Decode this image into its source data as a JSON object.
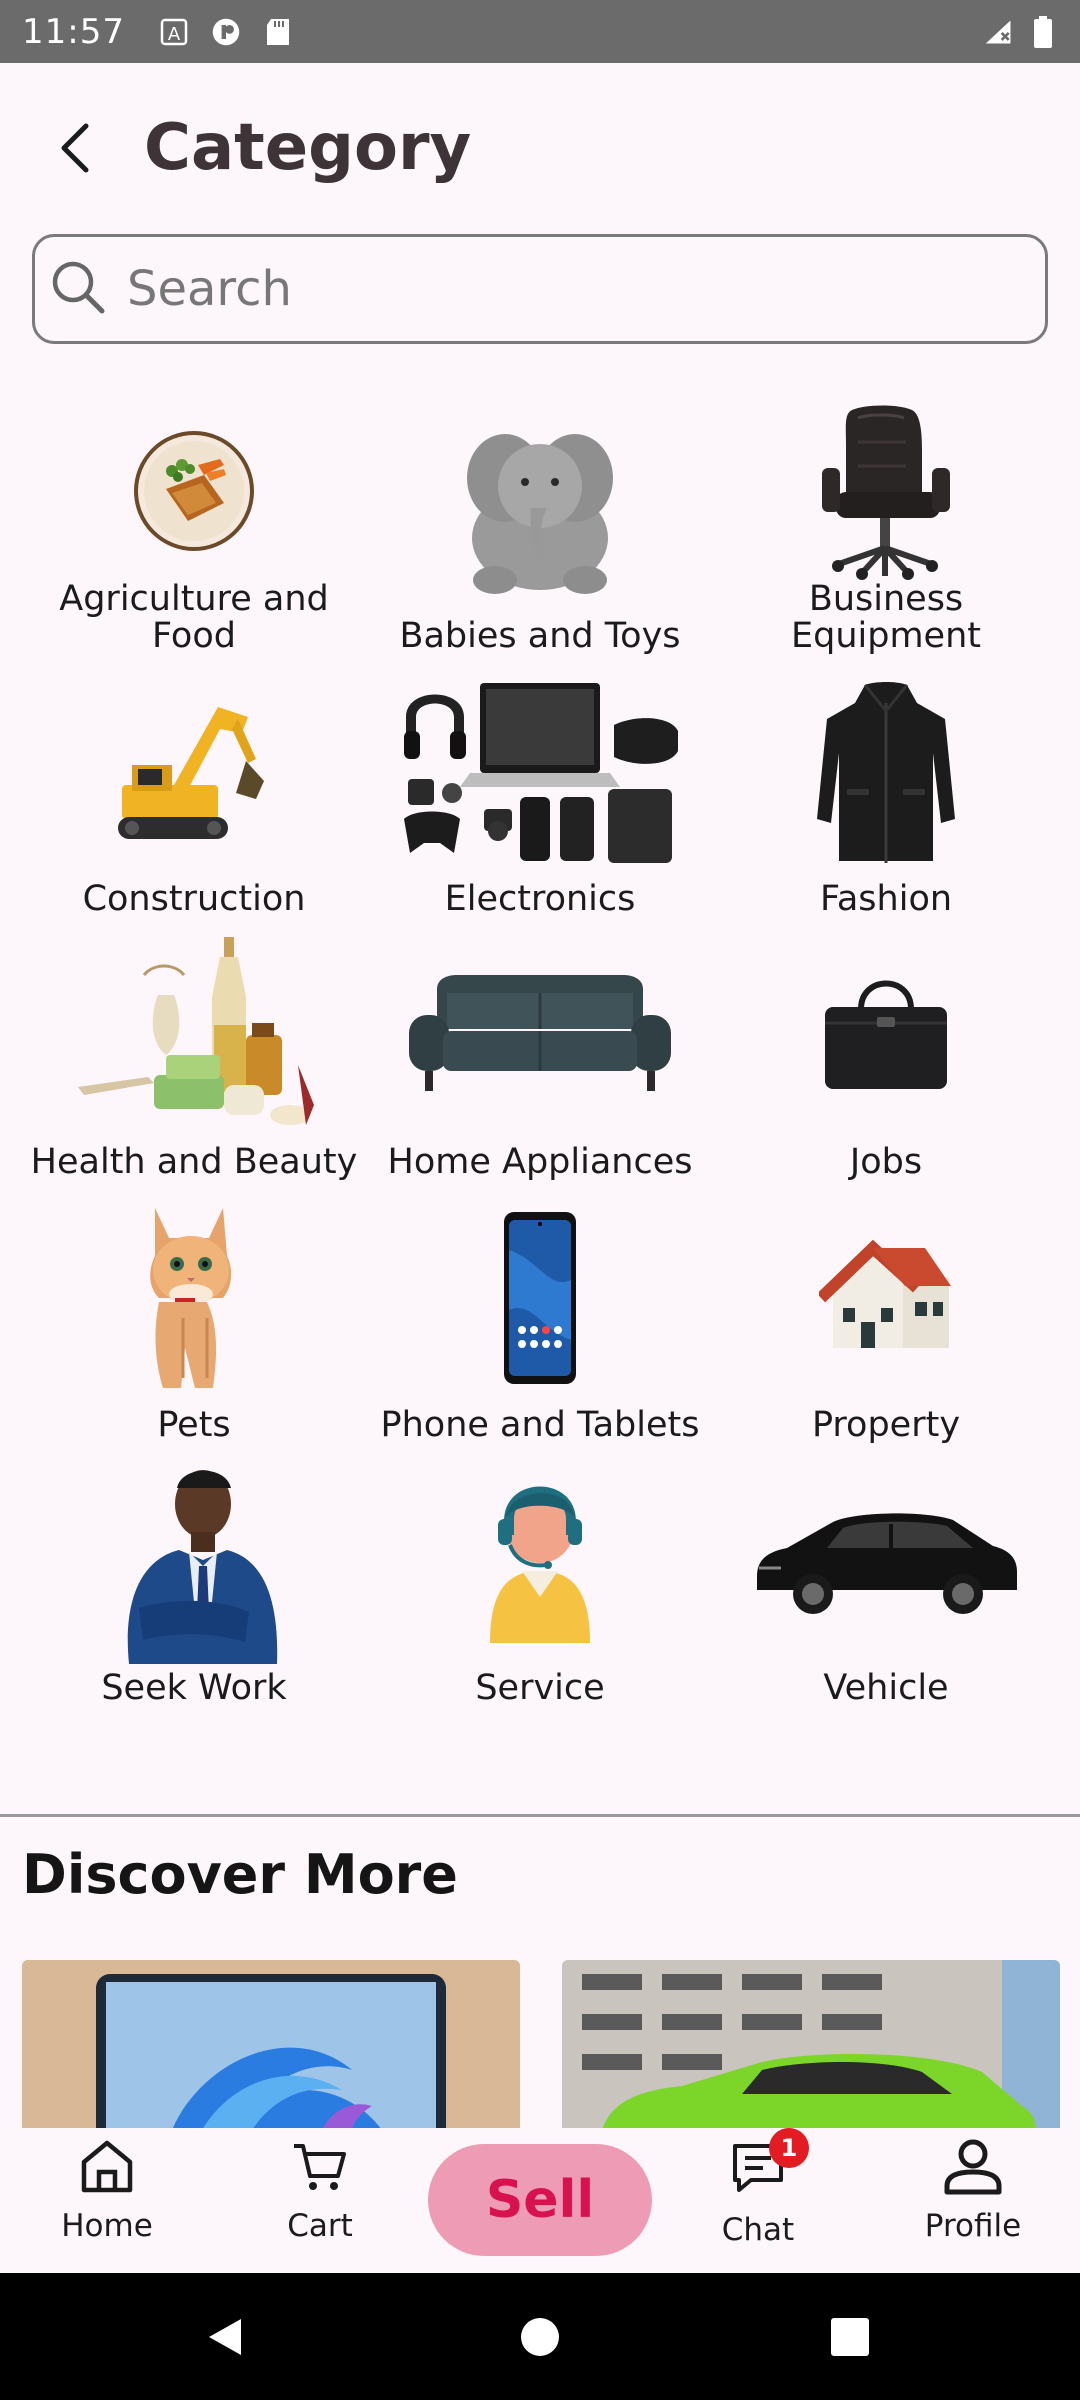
{
  "status_bar": {
    "time": "11:57"
  },
  "header": {
    "title": "Category"
  },
  "search": {
    "placeholder": "Search"
  },
  "categories": [
    {
      "label": "Agriculture and Food",
      "icon": "agriculture-food-icon"
    },
    {
      "label": "Babies and Toys",
      "icon": "toy-elephant-icon"
    },
    {
      "label": "Business Equipment",
      "icon": "office-chair-icon"
    },
    {
      "label": "Construction",
      "icon": "excavator-icon"
    },
    {
      "label": "Electronics",
      "icon": "electronics-icon"
    },
    {
      "label": "Fashion",
      "icon": "jacket-icon"
    },
    {
      "label": "Health and Beauty",
      "icon": "beauty-products-icon"
    },
    {
      "label": "Home Appliances",
      "icon": "sofa-icon"
    },
    {
      "label": "Jobs",
      "icon": "briefcase-icon"
    },
    {
      "label": "Pets",
      "icon": "cat-icon"
    },
    {
      "label": "Phone and Tablets",
      "icon": "smartphone-icon"
    },
    {
      "label": "Property",
      "icon": "house-icon"
    },
    {
      "label": "Seek Work",
      "icon": "businessman-icon"
    },
    {
      "label": "Service",
      "icon": "support-agent-icon"
    },
    {
      "label": "Vehicle",
      "icon": "car-icon"
    }
  ],
  "discover": {
    "title": "Discover More"
  },
  "bottom_nav": {
    "home": "Home",
    "cart": "Cart",
    "sell": "Sell",
    "chat": "Chat",
    "chat_badge": "1",
    "profile": "Profile"
  },
  "colors": {
    "sell_bg": "#ee9bb6",
    "sell_text": "#d8124f",
    "badge": "#e31b23"
  }
}
